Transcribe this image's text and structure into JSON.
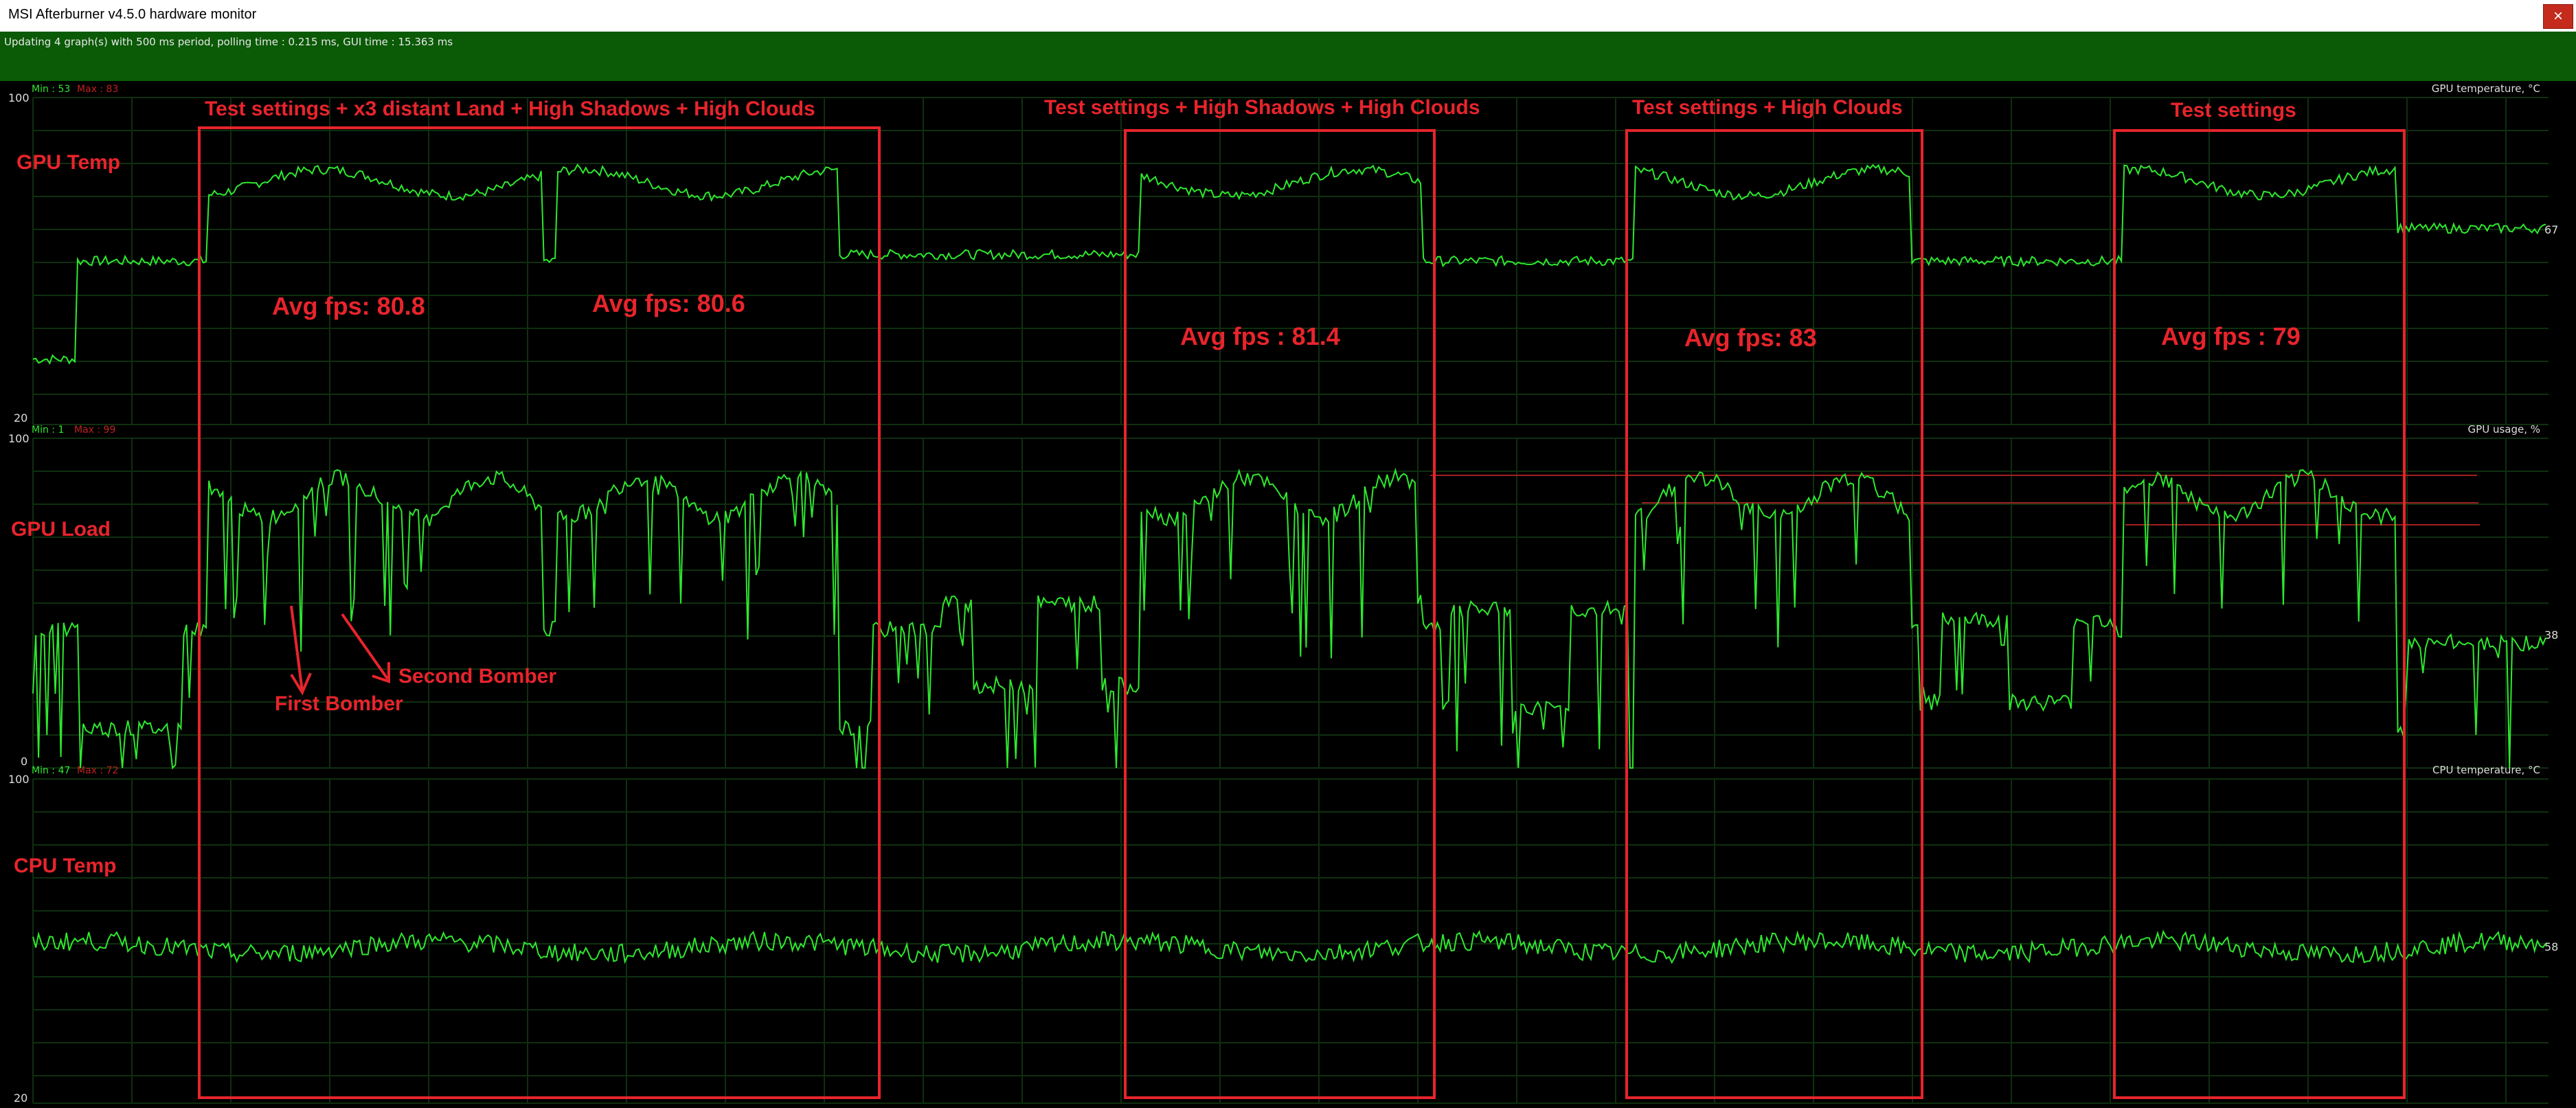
{
  "window": {
    "title": "MSI Afterburner v4.5.0 hardware monitor",
    "close_glyph": "×"
  },
  "status": {
    "text": "Updating 4 graph(s) with 500 ms period, polling time : 0.215 ms, GUI time : 15.363 ms"
  },
  "colors": {
    "trace": "#2ee82e",
    "grid": "#0f2f0f",
    "annotation": "#e8242c",
    "status_bg": "#0a5a06",
    "threshold": "#a02020"
  },
  "graphs": [
    {
      "name": "GPU temperature, °C",
      "min_label": "Min : 53",
      "max_label": "Max : 83",
      "axis_top": "100",
      "axis_bottom": "20",
      "current": "67",
      "ylim": [
        20,
        100
      ]
    },
    {
      "name": "GPU usage, %",
      "min_label": "Min : 1",
      "max_label": "Max : 99",
      "axis_top": "100",
      "axis_bottom": "0",
      "current": "38",
      "ylim": [
        0,
        100
      ]
    },
    {
      "name": "CPU temperature, °C",
      "min_label": "Min : 47",
      "max_label": "Max : 72",
      "axis_top": "100",
      "axis_bottom": "20",
      "current": "58",
      "ylim": [
        20,
        100
      ]
    }
  ],
  "annotations": {
    "side_labels": [
      "GPU Temp",
      "GPU Load",
      "CPU Temp"
    ],
    "sections": [
      {
        "title": "Test settings + x3 distant Land + High Shadows + High Clouds",
        "fps": [
          "Avg fps: 80.8",
          "Avg fps: 80.6"
        ]
      },
      {
        "title": "Test settings + High Shadows + High Clouds",
        "fps": [
          "Avg fps : 81.4"
        ]
      },
      {
        "title": "Test settings + High Clouds",
        "fps": [
          "Avg fps: 83"
        ]
      },
      {
        "title": "Test settings",
        "fps": [
          "Avg fps : 79"
        ]
      }
    ],
    "arrows": [
      "First Bomber",
      "Second Bomber"
    ]
  }
}
